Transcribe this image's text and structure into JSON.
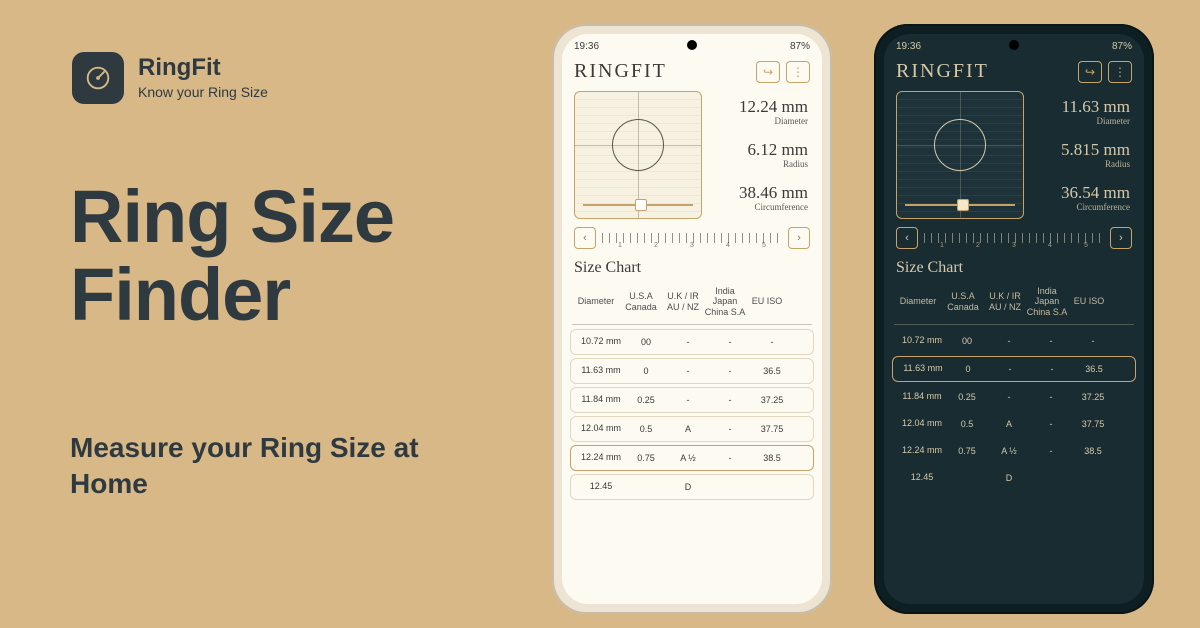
{
  "brand": {
    "name": "RingFit",
    "tagline": "Know your Ring Size"
  },
  "hero": {
    "title_line1": "Ring Size",
    "title_line2": "Finder",
    "subtitle": "Measure your Ring Size at Home"
  },
  "status": {
    "time": "19:36",
    "battery": "87%"
  },
  "app": {
    "title": "RINGFIT",
    "share_icon": "↪",
    "menu_icon": "⋮",
    "prev_icon": "‹",
    "next_icon": "›",
    "ruler_numbers": [
      "1",
      "2",
      "3",
      "4",
      "5"
    ]
  },
  "light_phone": {
    "diameter": "12.24 mm",
    "diameter_label": "Diameter",
    "radius": "6.12 mm",
    "radius_label": "Radius",
    "circumference": "38.46 mm",
    "circumference_label": "Circumference",
    "selected_index": 4
  },
  "dark_phone": {
    "diameter": "11.63 mm",
    "diameter_label": "Diameter",
    "radius": "5.815 mm",
    "radius_label": "Radius",
    "circumference": "36.54 mm",
    "circumference_label": "Circumference",
    "selected_index": 1
  },
  "size_chart": {
    "title": "Size Chart",
    "columns": [
      "Diameter",
      "U.S.A Canada",
      "U.K / IR AU / NZ",
      "India Japan China S.A",
      "EU ISO"
    ],
    "rows": [
      {
        "diameter": "10.72 mm",
        "usa": "00",
        "uk": "-",
        "asia": "-",
        "eu": "-"
      },
      {
        "diameter": "11.63 mm",
        "usa": "0",
        "uk": "-",
        "asia": "-",
        "eu": "36.5"
      },
      {
        "diameter": "11.84 mm",
        "usa": "0.25",
        "uk": "-",
        "asia": "-",
        "eu": "37.25"
      },
      {
        "diameter": "12.04 mm",
        "usa": "0.5",
        "uk": "A",
        "asia": "-",
        "eu": "37.75"
      },
      {
        "diameter": "12.24 mm",
        "usa": "0.75",
        "uk": "A ½",
        "asia": "-",
        "eu": "38.5"
      },
      {
        "diameter": "12.45",
        "usa": "",
        "uk": "D",
        "asia": "",
        "eu": ""
      }
    ]
  }
}
